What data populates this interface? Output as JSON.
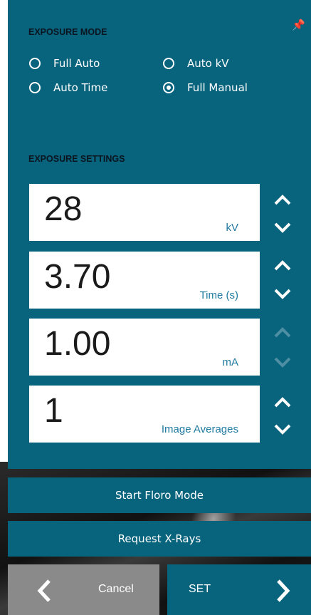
{
  "exposure_mode": {
    "title": "EXPOSURE MODE",
    "options": [
      {
        "label": "Full Auto",
        "selected": false
      },
      {
        "label": "Auto kV",
        "selected": false
      },
      {
        "label": "Auto Time",
        "selected": false
      },
      {
        "label": "Full Manual",
        "selected": true
      }
    ]
  },
  "exposure_settings": {
    "title": "EXPOSURE SETTINGS",
    "fields": [
      {
        "value": "28",
        "unit": "kV",
        "arrows_enabled": true
      },
      {
        "value": "3.70",
        "unit": "Time (s)",
        "arrows_enabled": true
      },
      {
        "value": "1.00",
        "unit": "mA",
        "arrows_enabled": false
      },
      {
        "value": "1",
        "unit": "Image Averages",
        "arrows_enabled": true
      }
    ]
  },
  "buttons": {
    "floro": "Start Floro Mode",
    "request": "Request X-Rays",
    "cancel": "Cancel",
    "set": "SET"
  },
  "icons": {
    "pin": "pin-icon",
    "increment": "chevron-up-icon",
    "decrement": "chevron-down-icon",
    "back": "chevron-left-icon",
    "forward": "chevron-right-icon"
  },
  "colors": {
    "panel": "#08637d",
    "disabled_arrow": "#4e8fa4",
    "cancel_bg": "#8a8a8a"
  }
}
